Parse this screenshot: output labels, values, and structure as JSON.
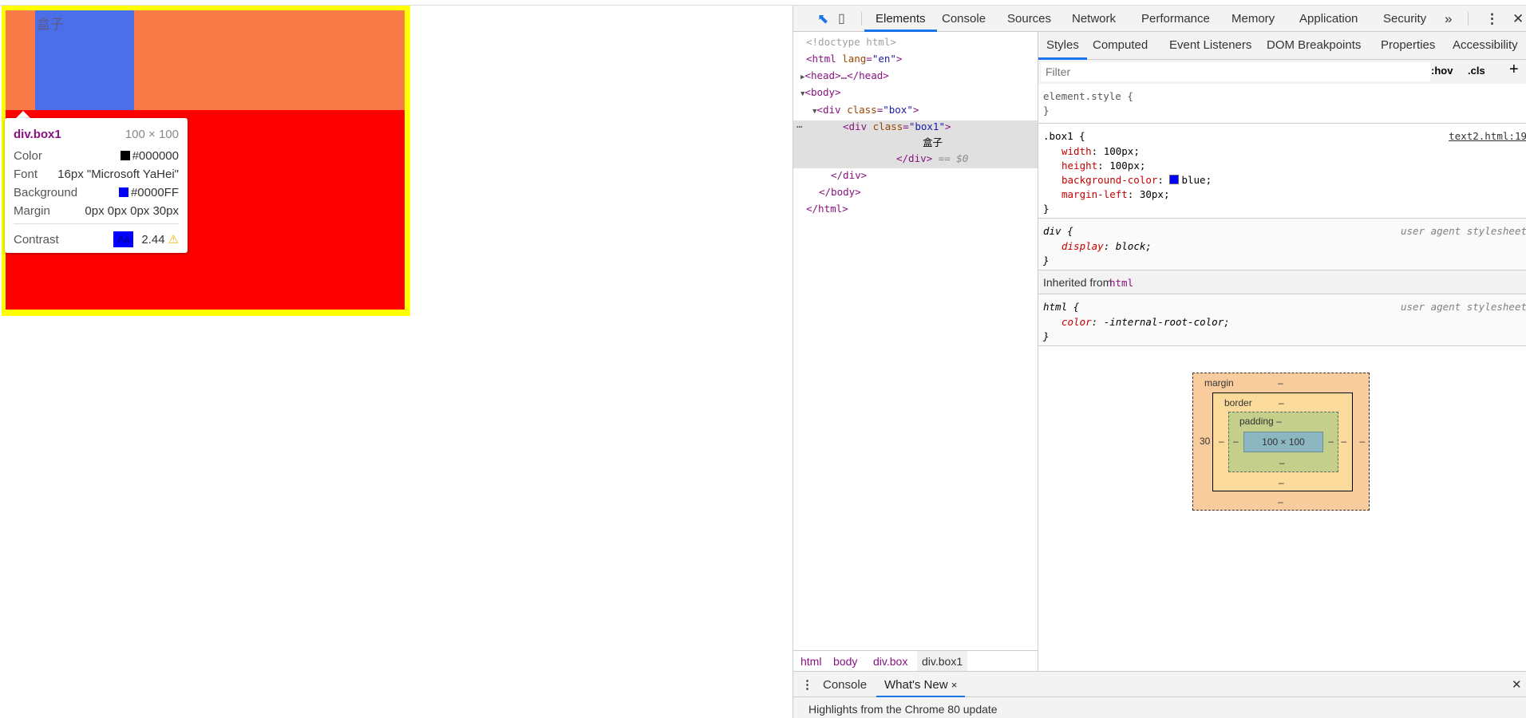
{
  "page": {
    "box_text": "盒子",
    "colors": {
      "outer_border": "#ffff00",
      "box": "#ff7f50",
      "box_highlight": "#f97b48",
      "box1": "#4a6fe8",
      "lower": "#ff0000"
    }
  },
  "tooltip": {
    "selector": "div.box1",
    "size": "100 × 100",
    "rows": [
      {
        "label": "Color",
        "value": "#000000",
        "swatch": "#000000"
      },
      {
        "label": "Font",
        "value": "16px \"Microsoft YaHei\""
      },
      {
        "label": "Background",
        "value": "#0000FF",
        "swatch": "#0000ff"
      },
      {
        "label": "Margin",
        "value": "0px 0px 0px 30px"
      }
    ],
    "contrast_label": "Contrast",
    "contrast_sample": "Aa",
    "contrast_value": "2.44",
    "warning_icon": "warning-triangle"
  },
  "devtools": {
    "tabs": [
      "Elements",
      "Console",
      "Sources",
      "Network",
      "Performance",
      "Memory",
      "Application",
      "Security"
    ],
    "more": "»",
    "tree": {
      "doctype": "<!doctype html>",
      "html_open": "<html",
      "lang_attr": "lang",
      "lang_val": "\"en\"",
      "head": "<head>…</head>",
      "body_open": "<body>",
      "div_box": "<div",
      "class_attr": "class",
      "box_val": "\"box\"",
      "box1_val": "\"box1\"",
      "gt": ">",
      "text": "盒子",
      "div_close": "</div>",
      "dollar": " == $0",
      "body_close": "</body>",
      "html_close": "</html>"
    },
    "subtabs": [
      "Styles",
      "Computed",
      "Event Listeners",
      "DOM Breakpoints",
      "Properties",
      "Accessibility"
    ],
    "filter_placeholder": "Filter",
    "hov": ":hov",
    "cls": ".cls",
    "plus": "+",
    "rules": {
      "element_style": "element.style {",
      "close": "}",
      "box1": {
        "selector": ".box1",
        "source": "text2.html:19",
        "props": [
          {
            "name": "width",
            "value": "100px;"
          },
          {
            "name": "height",
            "value": "100px;"
          },
          {
            "name": "background-color",
            "value": "blue;",
            "swatch": "#0000ff"
          },
          {
            "name": "margin-left",
            "value": "30px;"
          }
        ]
      },
      "div": {
        "selector": "div",
        "source": "user agent stylesheet",
        "prop": "display",
        "value": "block;"
      },
      "inherited_label": "Inherited from",
      "inherited_tag": "html",
      "html": {
        "selector": "html",
        "source": "user agent stylesheet",
        "prop": "color",
        "value": "-internal-root-color;"
      }
    },
    "box_model": {
      "margin": "margin",
      "border": "border",
      "padding": "padding",
      "content": "100 × 100",
      "margin_left": "30",
      "dash": "–"
    },
    "breadcrumbs": [
      "html",
      "body",
      "div.box",
      "div.box1"
    ],
    "drawer": {
      "tabs": [
        "Console",
        "What's New"
      ],
      "close": "×",
      "headline": "Highlights from the Chrome 80 update"
    }
  }
}
